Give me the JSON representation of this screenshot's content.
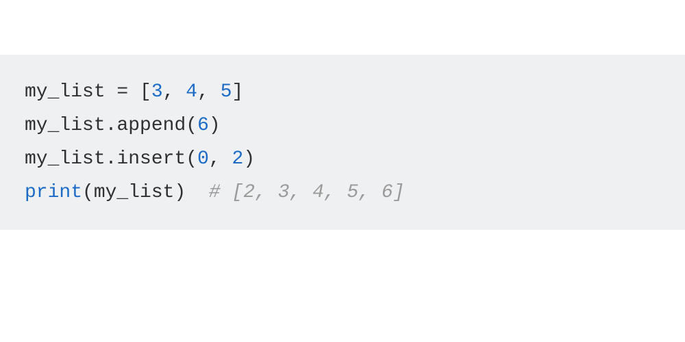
{
  "code": {
    "line1": {
      "var": "my_list",
      "assign": " = ",
      "lbracket": "[",
      "n1": "3",
      "c1": ", ",
      "n2": "4",
      "c2": ", ",
      "n3": "5",
      "rbracket": "]"
    },
    "line2": {
      "var": "my_list",
      "dot": ".",
      "method": "append",
      "lparen": "(",
      "arg": "6",
      "rparen": ")"
    },
    "line3": {
      "var": "my_list",
      "dot": ".",
      "method": "insert",
      "lparen": "(",
      "arg1": "0",
      "comma": ", ",
      "arg2": "2",
      "rparen": ")"
    },
    "line4": {
      "fn": "print",
      "lparen": "(",
      "var": "my_list",
      "rparen": ")",
      "spaces": "  ",
      "comment": "# [2, 3, 4, 5, 6]"
    }
  }
}
